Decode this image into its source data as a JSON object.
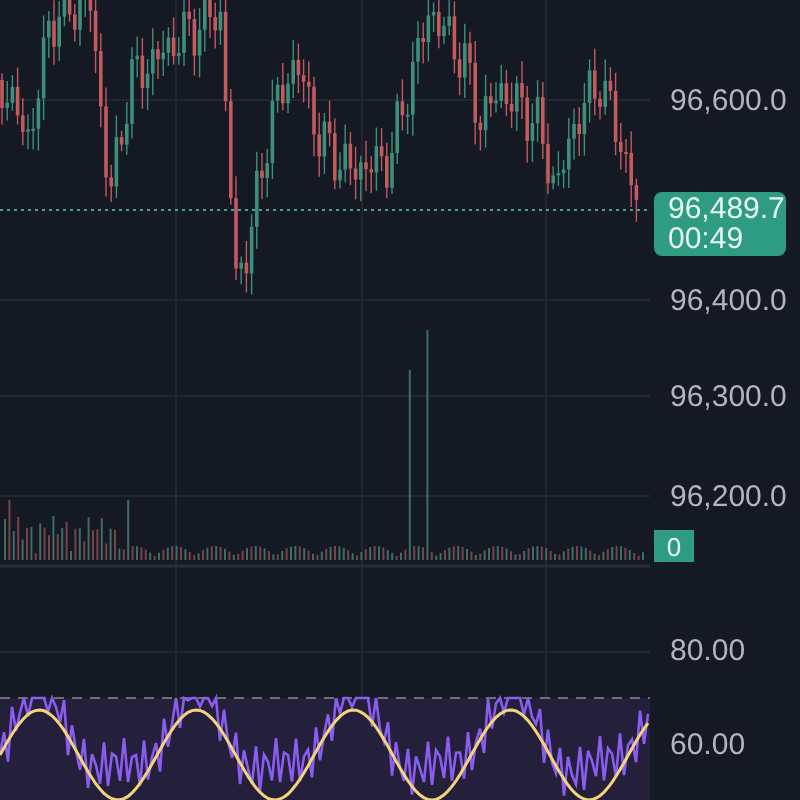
{
  "price_axis": {
    "labels": [
      "96,600.0",
      "96,400.0",
      "96,300.0",
      "96,200.0"
    ]
  },
  "last_price": {
    "price": "96,489.7",
    "countdown": "00:49"
  },
  "volume_badge": {
    "value": "0"
  },
  "rsi_axis": {
    "labels": [
      "80.00",
      "60.00"
    ]
  }
}
